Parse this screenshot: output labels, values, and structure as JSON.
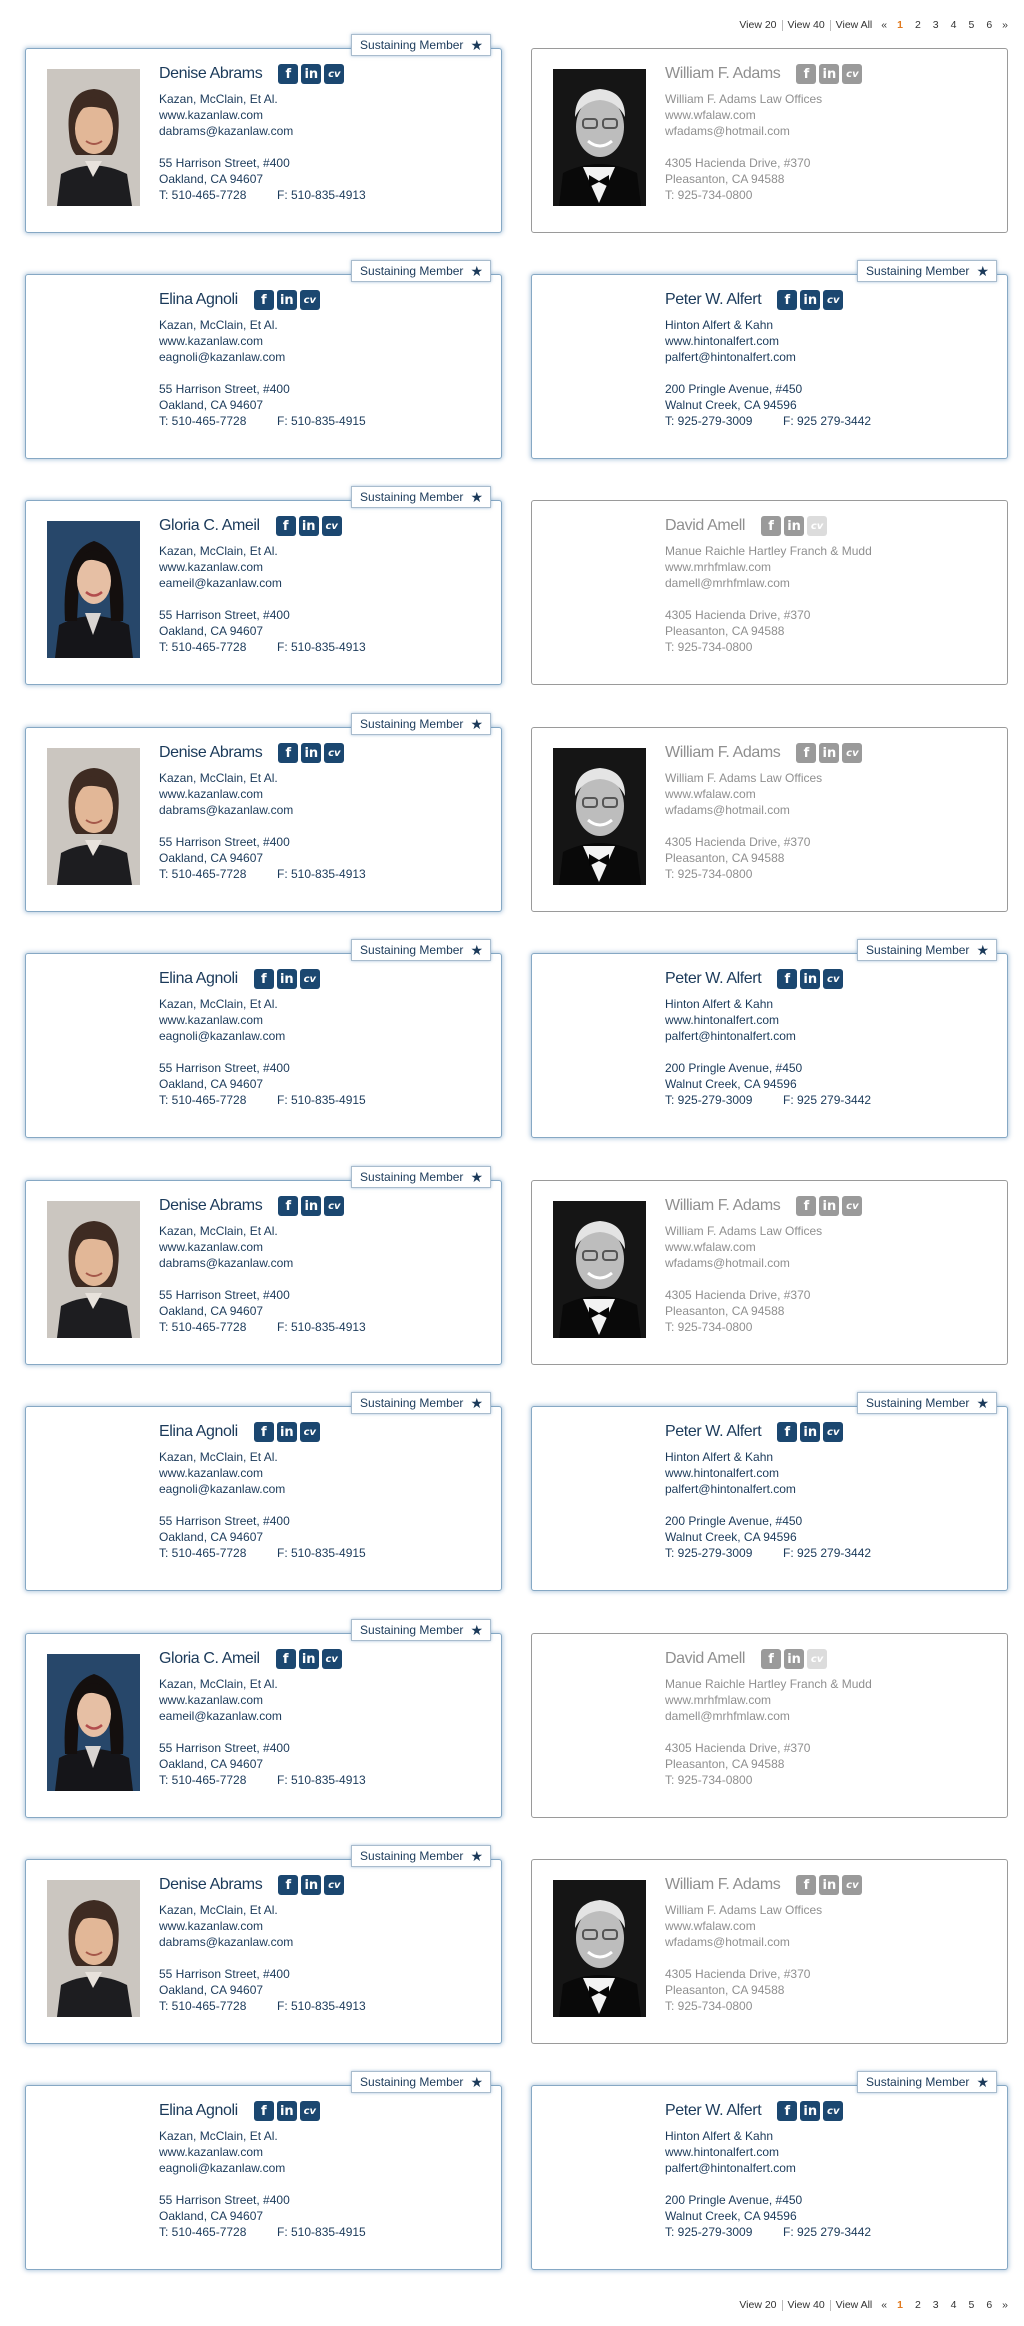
{
  "pagination": {
    "view20": "View 20",
    "view40": "View 40",
    "viewAll": "View All",
    "prev": "«",
    "next": "»",
    "pages": [
      "1",
      "2",
      "3",
      "4",
      "5",
      "6"
    ],
    "current": "1"
  },
  "badge_label": "Sustaining Member",
  "colors": {
    "brand_navy": "#1b4770",
    "text_navy": "#1b3a5a",
    "inactive_gray": "#8f8f8f",
    "active_page": "#e07a1f"
  },
  "social_icons": [
    "facebook-icon",
    "linkedin-icon",
    "cv-icon"
  ],
  "cards": [
    {
      "name": "Denise Abrams",
      "sustaining": true,
      "active": true,
      "photo": "denise",
      "firm": "Kazan, McClain, Et Al.",
      "web": "www.kazanlaw.com",
      "email": "dabrams@kazanlaw.com",
      "addr1": "55 Harrison Street, #400",
      "addr2": "Oakland, CA 94607",
      "tel": "T: 510-465-7728",
      "fax": "F: 510-835-4913",
      "cv": true
    },
    {
      "name": "William F. Adams",
      "sustaining": false,
      "active": false,
      "photo": "william",
      "firm": "William F. Adams Law Offices",
      "web": "www.wfalaw.com",
      "email": "wfadams@hotmail.com",
      "addr1": "4305 Hacienda Drive, #370",
      "addr2": "Pleasanton, CA 94588",
      "tel": "T: 925-734-0800",
      "fax": "",
      "cv": true
    },
    {
      "name": "Elina Agnoli",
      "sustaining": true,
      "active": true,
      "photo": "",
      "firm": "Kazan, McClain, Et Al.",
      "web": "www.kazanlaw.com",
      "email": "eagnoli@kazanlaw.com",
      "addr1": "55 Harrison Street, #400",
      "addr2": "Oakland, CA 94607",
      "tel": "T: 510-465-7728",
      "fax": "F: 510-835-4915",
      "cv": true
    },
    {
      "name": "Peter W. Alfert",
      "sustaining": true,
      "active": true,
      "photo": "",
      "firm": "Hinton Alfert & Kahn",
      "web": "www.hintonalfert.com",
      "email": "palfert@hintonalfert.com",
      "addr1": "200 Pringle Avenue, #450",
      "addr2": "Walnut Creek, CA 94596",
      "tel": "T: 925-279-3009",
      "fax": "F: 925 279-3442",
      "cv": true
    },
    {
      "name": "Gloria C. Ameil",
      "sustaining": true,
      "active": true,
      "photo": "gloria",
      "firm": "Kazan, McClain, Et Al.",
      "web": "www.kazanlaw.com",
      "email": "eameil@kazanlaw.com",
      "addr1": "55 Harrison Street, #400",
      "addr2": "Oakland, CA 94607",
      "tel": "T: 510-465-7728",
      "fax": "F: 510-835-4913",
      "cv": true
    },
    {
      "name": "David Amell",
      "sustaining": false,
      "active": false,
      "photo": "",
      "firm": "Manue Raichle Hartley Franch & Mudd",
      "web": "www.mrhfmlaw.com",
      "email": "damell@mrhfmlaw.com",
      "addr1": "4305 Hacienda Drive, #370",
      "addr2": "Pleasanton, CA 94588",
      "tel": "T: 925-734-0800",
      "fax": "",
      "cv": false
    },
    {
      "name": "Denise Abrams",
      "sustaining": true,
      "active": true,
      "photo": "denise",
      "firm": "Kazan, McClain, Et Al.",
      "web": "www.kazanlaw.com",
      "email": "dabrams@kazanlaw.com",
      "addr1": "55 Harrison Street, #400",
      "addr2": "Oakland, CA 94607",
      "tel": "T: 510-465-7728",
      "fax": "F: 510-835-4913",
      "cv": true
    },
    {
      "name": "William F. Adams",
      "sustaining": false,
      "active": false,
      "photo": "william",
      "firm": "William F. Adams Law Offices",
      "web": "www.wfalaw.com",
      "email": "wfadams@hotmail.com",
      "addr1": "4305 Hacienda Drive, #370",
      "addr2": "Pleasanton, CA 94588",
      "tel": "T: 925-734-0800",
      "fax": "",
      "cv": true
    },
    {
      "name": "Elina Agnoli",
      "sustaining": true,
      "active": true,
      "photo": "",
      "firm": "Kazan, McClain, Et Al.",
      "web": "www.kazanlaw.com",
      "email": "eagnoli@kazanlaw.com",
      "addr1": "55 Harrison Street, #400",
      "addr2": "Oakland, CA 94607",
      "tel": "T: 510-465-7728",
      "fax": "F: 510-835-4915",
      "cv": true
    },
    {
      "name": "Peter W. Alfert",
      "sustaining": true,
      "active": true,
      "photo": "",
      "firm": "Hinton Alfert & Kahn",
      "web": "www.hintonalfert.com",
      "email": "palfert@hintonalfert.com",
      "addr1": "200 Pringle Avenue, #450",
      "addr2": "Walnut Creek, CA 94596",
      "tel": "T: 925-279-3009",
      "fax": "F: 925 279-3442",
      "cv": true
    },
    {
      "name": "Denise Abrams",
      "sustaining": true,
      "active": true,
      "photo": "denise",
      "firm": "Kazan, McClain, Et Al.",
      "web": "www.kazanlaw.com",
      "email": "dabrams@kazanlaw.com",
      "addr1": "55 Harrison Street, #400",
      "addr2": "Oakland, CA 94607",
      "tel": "T: 510-465-7728",
      "fax": "F: 510-835-4913",
      "cv": true
    },
    {
      "name": "William F. Adams",
      "sustaining": false,
      "active": false,
      "photo": "william",
      "firm": "William F. Adams Law Offices",
      "web": "www.wfalaw.com",
      "email": "wfadams@hotmail.com",
      "addr1": "4305 Hacienda Drive, #370",
      "addr2": "Pleasanton, CA 94588",
      "tel": "T: 925-734-0800",
      "fax": "",
      "cv": true
    },
    {
      "name": "Elina Agnoli",
      "sustaining": true,
      "active": true,
      "photo": "",
      "firm": "Kazan, McClain, Et Al.",
      "web": "www.kazanlaw.com",
      "email": "eagnoli@kazanlaw.com",
      "addr1": "55 Harrison Street, #400",
      "addr2": "Oakland, CA 94607",
      "tel": "T: 510-465-7728",
      "fax": "F: 510-835-4915",
      "cv": true
    },
    {
      "name": "Peter W. Alfert",
      "sustaining": true,
      "active": true,
      "photo": "",
      "firm": "Hinton Alfert & Kahn",
      "web": "www.hintonalfert.com",
      "email": "palfert@hintonalfert.com",
      "addr1": "200 Pringle Avenue, #450",
      "addr2": "Walnut Creek, CA 94596",
      "tel": "T: 925-279-3009",
      "fax": "F: 925 279-3442",
      "cv": true
    },
    {
      "name": "Gloria C. Ameil",
      "sustaining": true,
      "active": true,
      "photo": "gloria",
      "firm": "Kazan, McClain, Et Al.",
      "web": "www.kazanlaw.com",
      "email": "eameil@kazanlaw.com",
      "addr1": "55 Harrison Street, #400",
      "addr2": "Oakland, CA 94607",
      "tel": "T: 510-465-7728",
      "fax": "F: 510-835-4913",
      "cv": true
    },
    {
      "name": "David Amell",
      "sustaining": false,
      "active": false,
      "photo": "",
      "firm": "Manue Raichle Hartley Franch & Mudd",
      "web": "www.mrhfmlaw.com",
      "email": "damell@mrhfmlaw.com",
      "addr1": "4305 Hacienda Drive, #370",
      "addr2": "Pleasanton, CA 94588",
      "tel": "T: 925-734-0800",
      "fax": "",
      "cv": false
    },
    {
      "name": "Denise Abrams",
      "sustaining": true,
      "active": true,
      "photo": "denise",
      "firm": "Kazan, McClain, Et Al.",
      "web": "www.kazanlaw.com",
      "email": "dabrams@kazanlaw.com",
      "addr1": "55 Harrison Street, #400",
      "addr2": "Oakland, CA 94607",
      "tel": "T: 510-465-7728",
      "fax": "F: 510-835-4913",
      "cv": true
    },
    {
      "name": "William F. Adams",
      "sustaining": false,
      "active": false,
      "photo": "william",
      "firm": "William F. Adams Law Offices",
      "web": "www.wfalaw.com",
      "email": "wfadams@hotmail.com",
      "addr1": "4305 Hacienda Drive, #370",
      "addr2": "Pleasanton, CA 94588",
      "tel": "T: 925-734-0800",
      "fax": "",
      "cv": true
    },
    {
      "name": "Elina Agnoli",
      "sustaining": true,
      "active": true,
      "photo": "",
      "firm": "Kazan, McClain, Et Al.",
      "web": "www.kazanlaw.com",
      "email": "eagnoli@kazanlaw.com",
      "addr1": "55 Harrison Street, #400",
      "addr2": "Oakland, CA 94607",
      "tel": "T: 510-465-7728",
      "fax": "F: 510-835-4915",
      "cv": true
    },
    {
      "name": "Peter W. Alfert",
      "sustaining": true,
      "active": true,
      "photo": "",
      "firm": "Hinton Alfert & Kahn",
      "web": "www.hintonalfert.com",
      "email": "palfert@hintonalfert.com",
      "addr1": "200 Pringle Avenue, #450",
      "addr2": "Walnut Creek, CA 94596",
      "tel": "T: 925-279-3009",
      "fax": "F: 925 279-3442",
      "cv": true
    }
  ]
}
